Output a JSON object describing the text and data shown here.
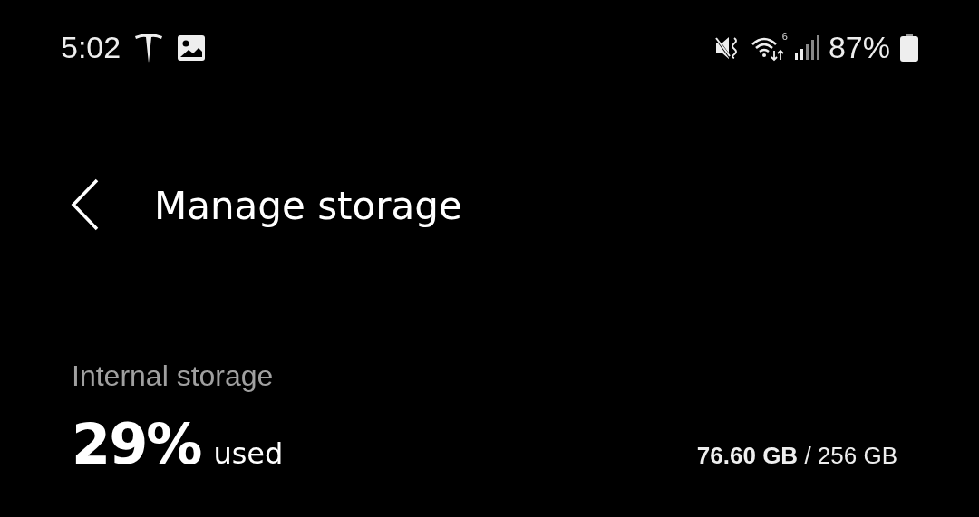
{
  "status_bar": {
    "time": "5:02",
    "wifi_badge": "6",
    "battery": "87%"
  },
  "header": {
    "title": "Manage storage"
  },
  "storage": {
    "label": "Internal storage",
    "percent": "29%",
    "used_label": "used",
    "amount": "**76.60 GB** / 256 GB"
  }
}
